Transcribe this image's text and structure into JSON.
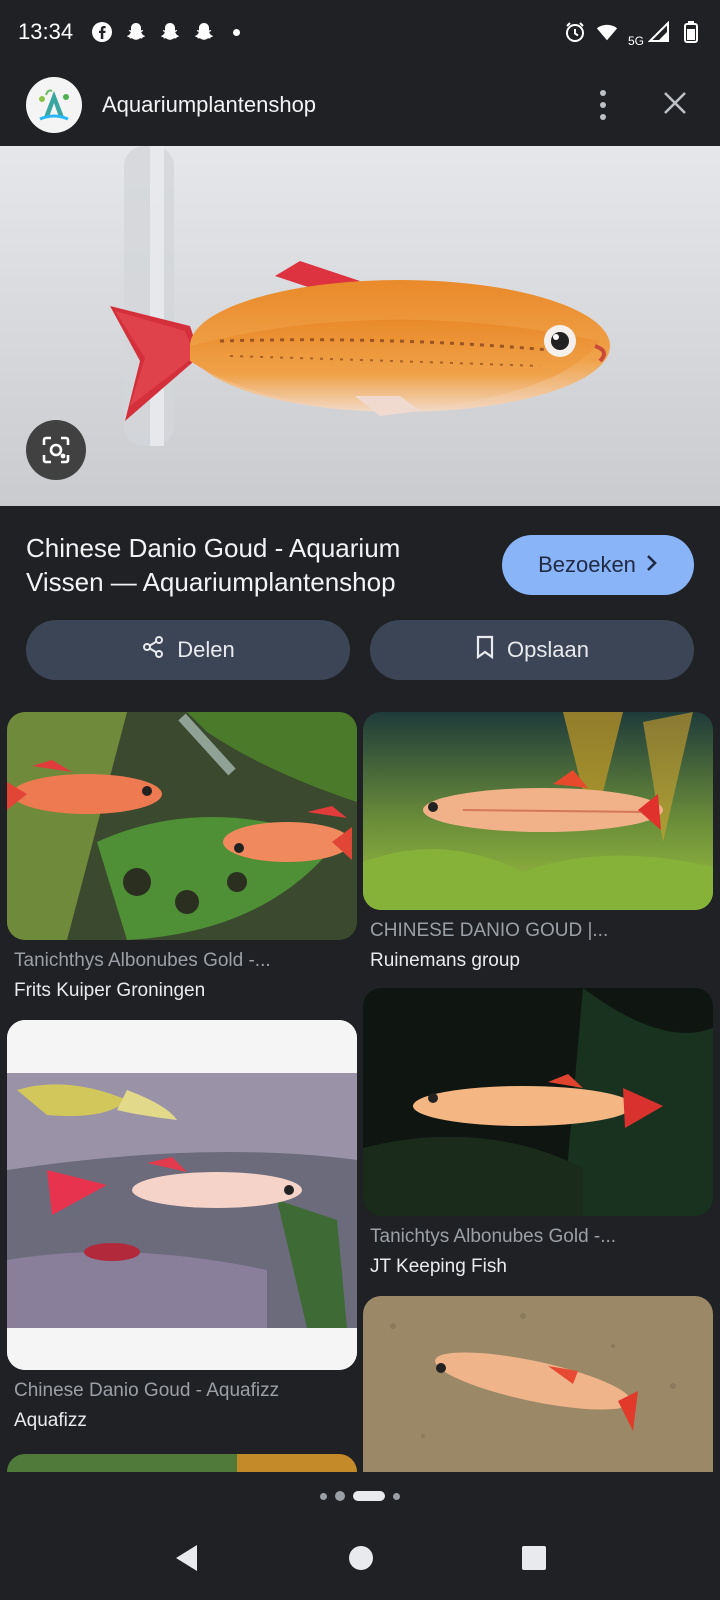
{
  "status_bar": {
    "time": "13:34",
    "network": "5G",
    "left_icons": [
      "facebook-icon",
      "snapchat-icon",
      "snapchat-icon",
      "snapchat-icon"
    ],
    "right_icons": [
      "alarm-icon",
      "wifi-icon",
      "signal-icon",
      "battery-icon"
    ]
  },
  "header": {
    "site_name": "Aquariumplantenshop",
    "menu_icon": "more-vert-icon",
    "close_icon": "close-icon"
  },
  "result": {
    "title": "Chinese Danio Goud - Aquarium Vissen — Aquariumplantenshop",
    "visit_label": "Bezoeken",
    "share_label": "Delen",
    "save_label": "Opslaan"
  },
  "related": [
    {
      "title": "Tanichthys Albonubes Gold -...",
      "source": "Frits Kuiper Groningen"
    },
    {
      "title": "CHINESE DANIO GOUD |...",
      "source": "Ruinemans group"
    },
    {
      "title": "Chinese Danio Goud - Aquafizz",
      "source": "Aquafizz"
    },
    {
      "title": "Tanichtys Albonubes Gold -...",
      "source": "JT Keeping Fish"
    },
    {
      "title": "",
      "source": ""
    },
    {
      "title": "",
      "source": ""
    }
  ],
  "carousel": {
    "count": 4,
    "active": 2
  },
  "colors": {
    "background": "#202124",
    "accent": "#8ab4f8",
    "pill": "#3c4556"
  }
}
